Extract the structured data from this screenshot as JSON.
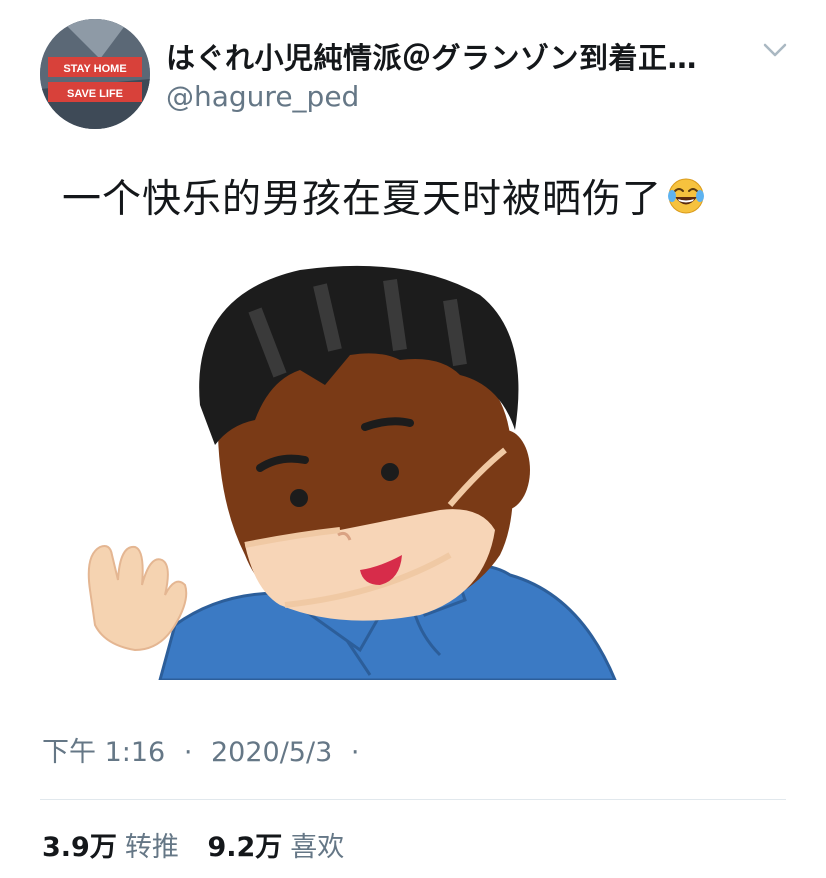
{
  "tweet": {
    "author": {
      "display_name": "はぐれ小児純情派＠グランゾン到着正…",
      "handle": "@hagure_ped",
      "avatar_badge_line1": "STAY HOME",
      "avatar_badge_line2": "SAVE LIFE"
    },
    "menu_icon": "chevron-down-icon",
    "text": "一个快乐的男孩在夏天时被晒伤了",
    "emoji": "face-with-tears-of-joy",
    "image": "illustration-boy-with-tan-line-from-mask",
    "time": "下午 1:16",
    "separator": "·",
    "date": "2020/5/3",
    "stats": {
      "retweets_count": "3.9万",
      "retweets_label": "转推",
      "likes_count": "9.2万",
      "likes_label": "喜欢"
    }
  },
  "colors": {
    "text_primary": "#14171a",
    "text_secondary": "#657786",
    "divider": "#e1e8ed",
    "skin_tanned": "#7a3a16",
    "skin_light": "#f7d5b7",
    "shirt": "#3a78c2"
  }
}
